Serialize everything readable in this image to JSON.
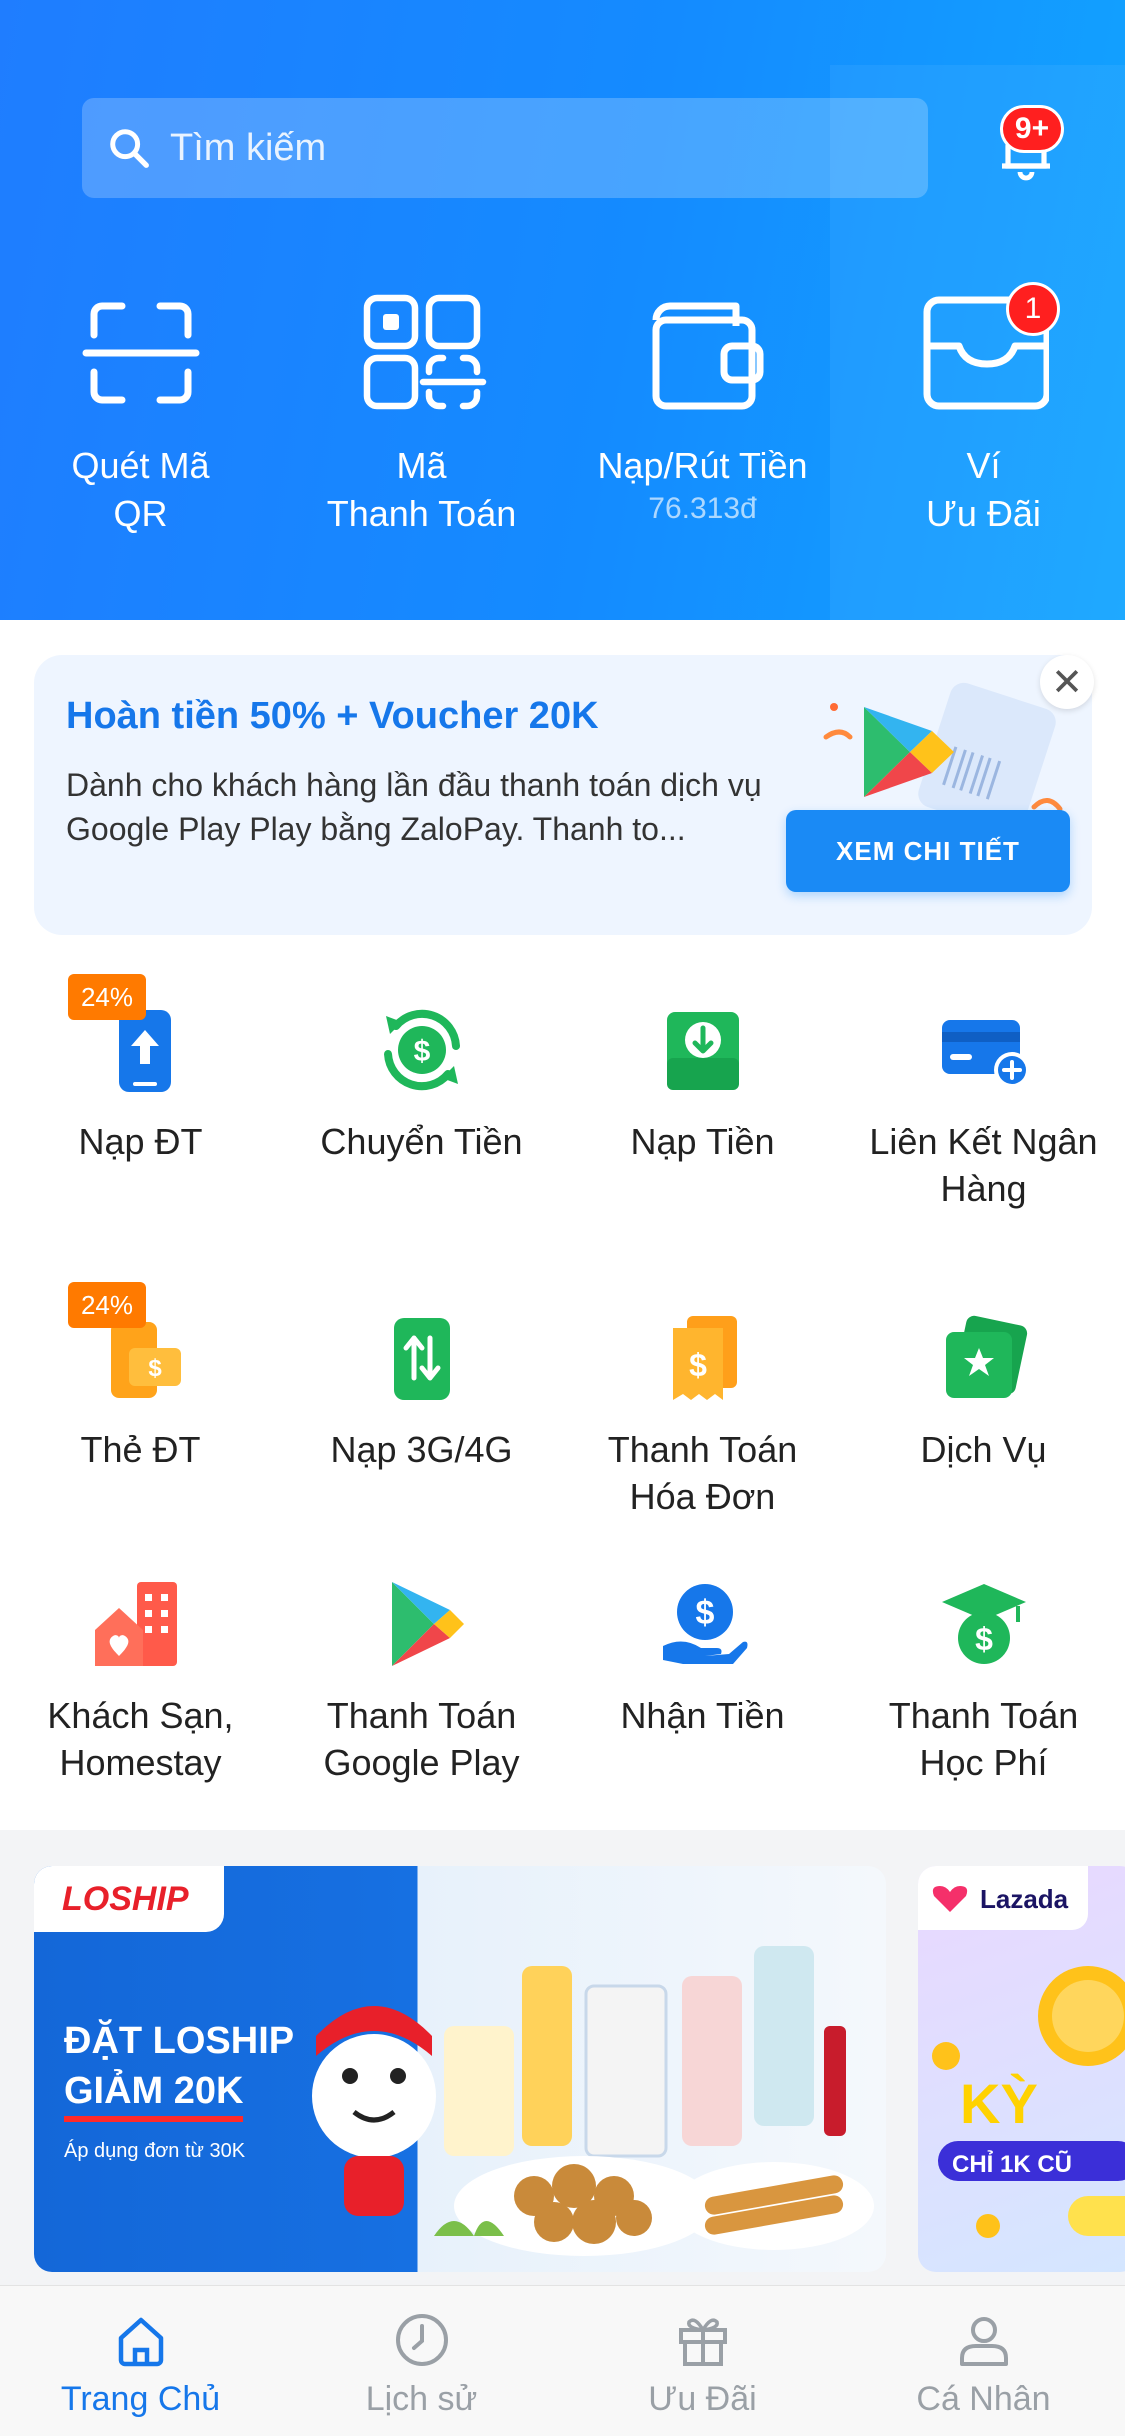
{
  "search": {
    "placeholder": "Tìm kiếm"
  },
  "notifications": {
    "badge": "9+"
  },
  "quick_actions": [
    {
      "label": "Quét Mã\nQR",
      "icon": "scan-qr-icon"
    },
    {
      "label": "Mã\nThanh Toán",
      "icon": "payment-code-icon"
    },
    {
      "label": "Nạp/Rút Tiền",
      "sub": "76.313đ",
      "icon": "wallet-icon"
    },
    {
      "label": "Ví\nƯu Đãi",
      "icon": "voucher-wallet-icon",
      "badge": "1"
    }
  ],
  "promo": {
    "title": "Hoàn tiền 50% + Voucher 20K",
    "description": "Dành cho khách hàng lần đầu thanh toán dịch vụ Google Play Play bằng ZaloPay. Thanh to...",
    "button": "XEM CHI TIẾT",
    "close": "✕"
  },
  "services": [
    {
      "label": "Nạp ĐT",
      "icon": "phone-topup-icon",
      "badge": "24%"
    },
    {
      "label": "Chuyển Tiền",
      "icon": "transfer-money-icon"
    },
    {
      "label": "Nạp Tiền",
      "icon": "deposit-icon"
    },
    {
      "label": "Liên Kết Ngân\nHàng",
      "icon": "link-bank-icon"
    },
    {
      "label": "Thẻ ĐT",
      "icon": "phone-card-icon",
      "badge": "24%"
    },
    {
      "label": "Nạp 3G/4G",
      "icon": "mobile-data-icon"
    },
    {
      "label": "Thanh Toán\nHóa Đơn",
      "icon": "bill-payment-icon"
    },
    {
      "label": "Dịch Vụ",
      "icon": "services-icon"
    },
    {
      "label": "Khách Sạn,\nHomestay",
      "icon": "hotel-icon"
    },
    {
      "label": "Thanh Toán\nGoogle Play",
      "icon": "google-play-icon"
    },
    {
      "label": "Nhận Tiền",
      "icon": "receive-money-icon"
    },
    {
      "label": "Thanh Toán\nHọc Phí",
      "icon": "tuition-icon"
    }
  ],
  "banners": [
    {
      "brand": "LOSHIP",
      "headline1": "ĐẶT LOSHIP",
      "headline2": "GIẢM 20K",
      "sub": "Áp dụng đơn từ 30K"
    },
    {
      "brand": "Lazada",
      "headline": "KỲ",
      "sub": "CHỈ 1K CŨ"
    }
  ],
  "tabbar": [
    {
      "label": "Trang Chủ",
      "icon": "home-icon",
      "active": true
    },
    {
      "label": "Lịch sử",
      "icon": "history-icon"
    },
    {
      "label": "Ưu Đãi",
      "icon": "gift-icon"
    },
    {
      "label": "Cá Nhân",
      "icon": "profile-icon"
    }
  ],
  "colors": {
    "primary": "#1677ea",
    "header": "#1f7dff",
    "badge": "#ff1f1f",
    "percent_badge": "#ff7a00"
  }
}
